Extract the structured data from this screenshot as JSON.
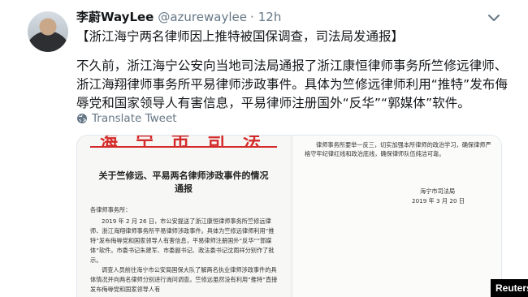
{
  "tweet": {
    "display_name": "李蔚WayLee",
    "handle": "@azurewaylee",
    "separator": "·",
    "time": "12h",
    "more_icon": "chevron-down-icon",
    "headline": "【浙江海宁两名律师因上推特被国保调查，司法局发通报】",
    "body": "不久前，浙江海宁公安向当地司法局通报了浙江康恒律师事务所竺修远律师、浙江海翔律师事务所平易律师涉政事件。具体为竺修远律师利用“推特”发布侮辱党和国家领导人有害信息，平易律师注册国外“反华”“郭媒体”软件。",
    "translate_label": "Translate Tweet"
  },
  "document": {
    "letterhead": "海宁市司法局",
    "title_line1": "关于竺修远、平易两名律师涉政事件的情况",
    "title_line2": "通报",
    "salutation": "各律师事务所：",
    "paragraph1": "2019 年 2 月 26 日，市公安提送了浙江康恒律师事务所竺修远律师、浙江海翔律师事务所平易律师涉政事件。具体为竺修远律师利用“推特”发布侮辱党和国家领导人有害信息，平易律师注册国外“反华”“郭媒体”软件。市委书记朱建军、市委副书记、政法委书记沈雨祥分别作了批示。",
    "paragraph2": "调查人员前往海宁市公安局国保大队了解两名执业律师涉政事件的具体情况并向两名律师分别进行询问调查。竺修远虽然没有利用“推特”直接发布侮辱党和国家领导人有",
    "right_text": "律师事务所要举一反三，切实加强本所律师的政治学习，确保律师严格守牢纪律红线和政治底线，确保律师队伍纯洁可靠。",
    "sign_org": "海宁市司法局",
    "sign_date": "2019 年 3 月 20 日"
  },
  "watermark": {
    "label": "Reuters"
  },
  "colors": {
    "name": "#14171a",
    "secondary": "#657786",
    "letterhead_red": "#d42a2a",
    "badge_bg": "#000000"
  }
}
